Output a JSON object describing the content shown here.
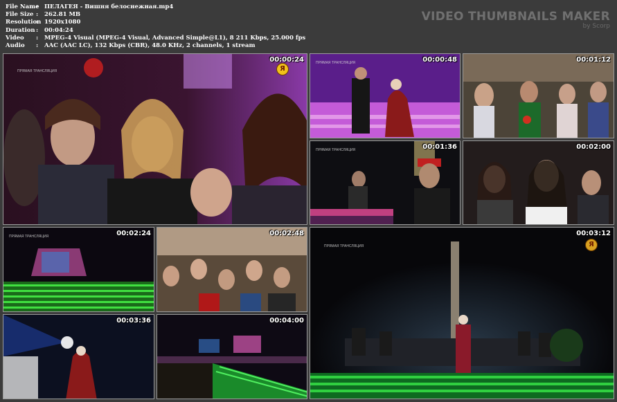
{
  "meta": {
    "rows": [
      {
        "key": "File Name",
        "value": "ПЕЛАГЕЯ - Вишня белоснежная.mp4"
      },
      {
        "key": "File Size",
        "value": "262.81 MB"
      },
      {
        "key": "Resolution",
        "value": "1920x1080"
      },
      {
        "key": "Duration",
        "value": "00:04:24"
      },
      {
        "key": "Video",
        "value": "MPEG-4 Visual (MPEG-4 Visual, Advanced Simple@L1), 8 211 Kbps, 25.000 fps"
      },
      {
        "key": "Audio",
        "value": "AAC (AAC LC), 132 Kbps (CBR), 48.0 KHz, 2 channels, 1 stream"
      }
    ],
    "separator": ":"
  },
  "brand": {
    "title": "VIDEO THUMBNAILS MAKER",
    "subtitle": "by Scorp"
  },
  "thumbnails": [
    {
      "timestamp": "00:00:24",
      "overlay": "ПРЯМАЯ ТРАНСЛЯЦИЯ"
    },
    {
      "timestamp": "00:00:48",
      "overlay": "ПРЯМАЯ ТРАНСЛЯЦИЯ"
    },
    {
      "timestamp": "00:01:12",
      "overlay": ""
    },
    {
      "timestamp": "00:01:36",
      "overlay": "ПРЯМАЯ ТРАНСЛЯЦИЯ"
    },
    {
      "timestamp": "00:02:00",
      "overlay": ""
    },
    {
      "timestamp": "00:02:24",
      "overlay": "ПРЯМАЯ ТРАНСЛЯЦИЯ"
    },
    {
      "timestamp": "00:02:48",
      "overlay": ""
    },
    {
      "timestamp": "00:03:12",
      "overlay": "ПРЯМАЯ ТРАНСЛЯЦИЯ"
    },
    {
      "timestamp": "00:03:36",
      "overlay": ""
    },
    {
      "timestamp": "00:04:00",
      "overlay": ""
    }
  ],
  "colors": {
    "background": "#3b3b3b",
    "text": "#ffffff",
    "brand": "#707070"
  }
}
